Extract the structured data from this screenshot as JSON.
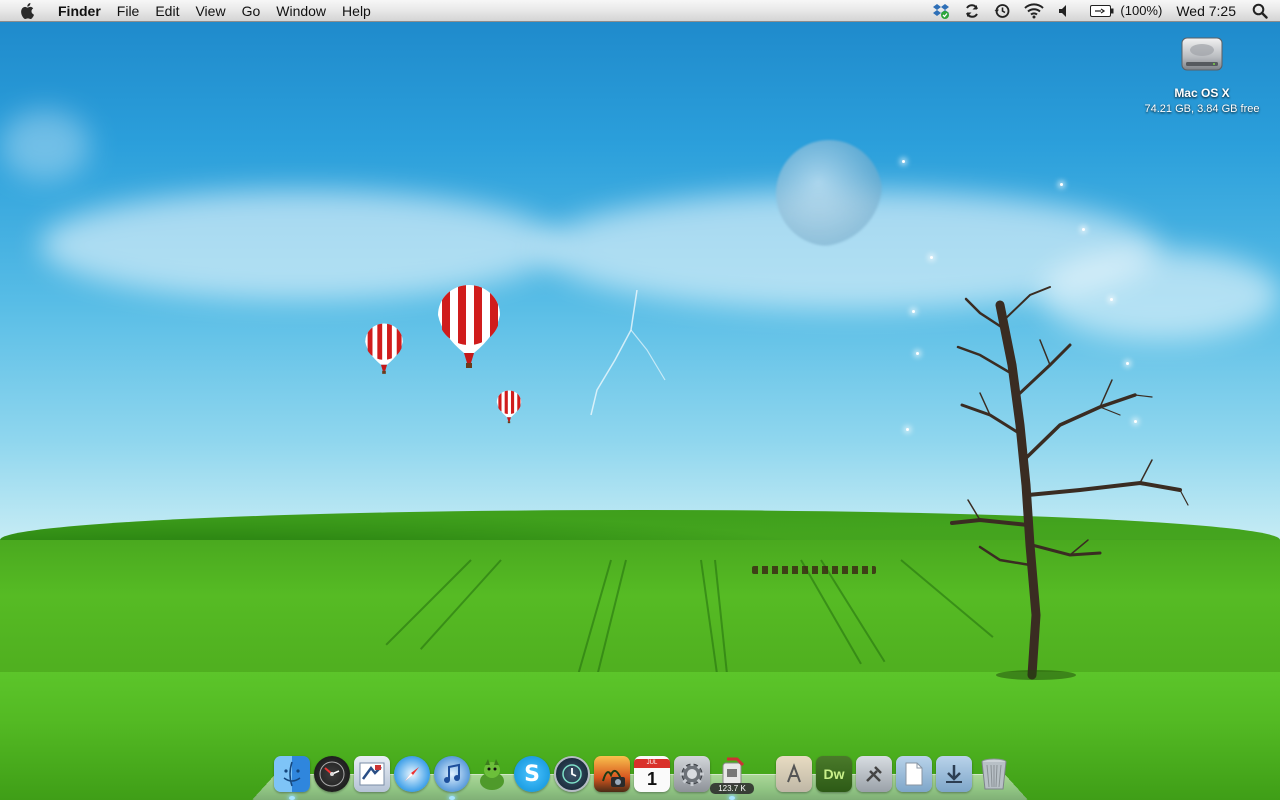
{
  "menubar": {
    "app_name": "Finder",
    "menus": [
      "File",
      "Edit",
      "View",
      "Go",
      "Window",
      "Help"
    ],
    "battery_text": "(100%)",
    "clock": "Wed 7:25",
    "status_icons": [
      "dropbox-icon",
      "sync-icon",
      "time-machine-icon",
      "wifi-icon",
      "volume-icon",
      "battery-icon",
      "spotlight-icon"
    ]
  },
  "desktop": {
    "drive": {
      "name": "Mac OS X",
      "info": "74.21 GB, 3.84 GB free"
    }
  },
  "dock": {
    "apps": [
      {
        "name": "finder",
        "running": true
      },
      {
        "name": "dashboard",
        "running": false
      },
      {
        "name": "mail",
        "running": false
      },
      {
        "name": "safari",
        "running": false
      },
      {
        "name": "itunes",
        "running": true
      },
      {
        "name": "adium",
        "running": false
      },
      {
        "name": "skype",
        "running": false
      },
      {
        "name": "time-machine",
        "running": false
      },
      {
        "name": "iphoto",
        "running": false
      },
      {
        "name": "ical",
        "running": false
      },
      {
        "name": "system-preferences",
        "running": false
      },
      {
        "name": "network-monitor",
        "running": true
      }
    ],
    "network_badge": "123.7 K",
    "calendar_day": "1",
    "calendar_month": "JUL",
    "stacks": [
      "applications-stack",
      "dreamweaver-stack",
      "utilities-stack",
      "documents-stack",
      "downloads-stack",
      "trash"
    ]
  },
  "colors": {
    "sky_top": "#1d87c9",
    "grass": "#53b923",
    "menubar": "#e8e8e8"
  }
}
